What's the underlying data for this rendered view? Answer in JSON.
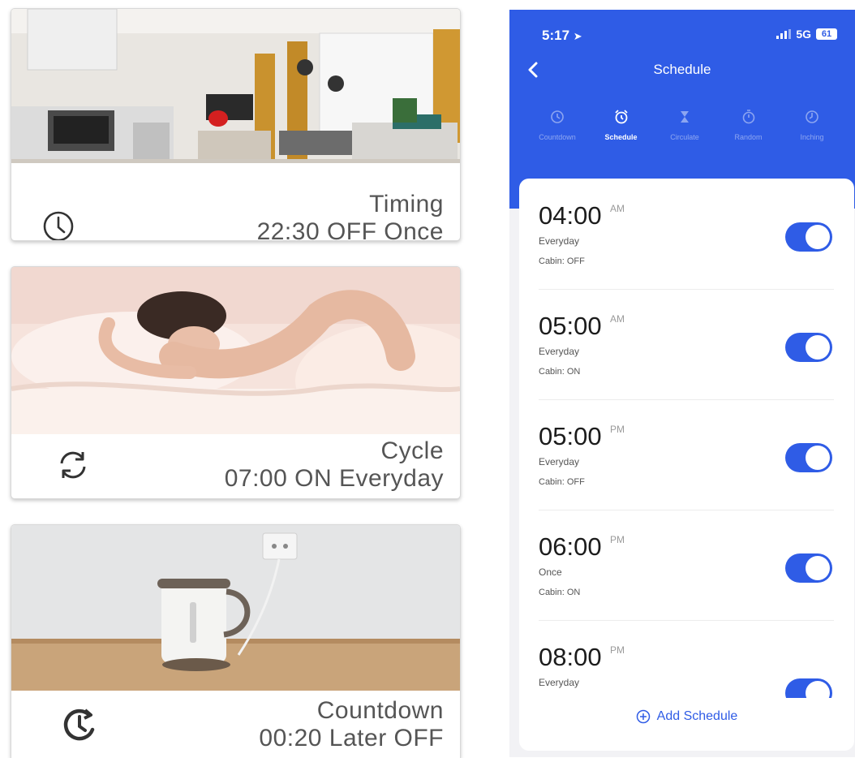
{
  "cards": {
    "timing": {
      "title": "Timing",
      "detail": "22:30 OFF Once",
      "icon": "clock-icon"
    },
    "cycle": {
      "title": "Cycle",
      "detail": "07:00 ON Everyday",
      "icon": "cycle-icon"
    },
    "countdown": {
      "title": "Countdown",
      "detail": "00:20 Later OFF",
      "icon": "countdown-icon"
    }
  },
  "phone": {
    "status": {
      "time": "5:17",
      "network": "5G",
      "battery": "61"
    },
    "title": "Schedule",
    "tabs": [
      {
        "label": "Countdown",
        "icon": "clock-icon"
      },
      {
        "label": "Schedule",
        "icon": "alarm-icon",
        "active": true
      },
      {
        "label": "Circulate",
        "icon": "hourglass-icon"
      },
      {
        "label": "Random",
        "icon": "stopwatch-icon"
      },
      {
        "label": "Inching",
        "icon": "timer-icon"
      }
    ],
    "schedules": [
      {
        "time": "04:00",
        "ampm": "AM",
        "repeat": "Everyday",
        "action": "Cabin: OFF",
        "enabled": true
      },
      {
        "time": "05:00",
        "ampm": "AM",
        "repeat": "Everyday",
        "action": "Cabin: ON",
        "enabled": true
      },
      {
        "time": "05:00",
        "ampm": "PM",
        "repeat": "Everyday",
        "action": "Cabin: OFF",
        "enabled": true
      },
      {
        "time": "06:00",
        "ampm": "PM",
        "repeat": "Once",
        "action": "Cabin: ON",
        "enabled": true
      },
      {
        "time": "08:00",
        "ampm": "PM",
        "repeat": "Everyday",
        "action": "",
        "enabled": true
      }
    ],
    "add_label": "Add Schedule"
  },
  "colors": {
    "accent": "#2f5ce6",
    "caption": "#555555"
  }
}
